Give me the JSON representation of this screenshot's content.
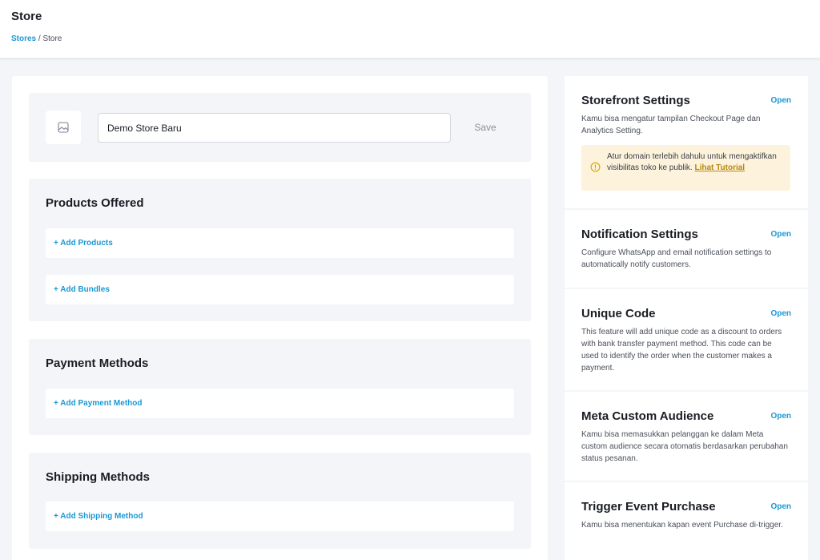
{
  "header": {
    "title": "Store",
    "breadcrumb": {
      "link": "Stores",
      "separator": "/",
      "current": "Store"
    }
  },
  "store": {
    "image_icon": "image-placeholder-icon",
    "name_value": "Demo Store Baru",
    "save_label": "Save"
  },
  "products_section": {
    "title": "Products Offered",
    "add_products": "+ Add Products",
    "add_bundles": "+ Add Bundles"
  },
  "payment_section": {
    "title": "Payment Methods",
    "add_payment": "+ Add Payment Method"
  },
  "shipping_section": {
    "title": "Shipping Methods",
    "add_shipping": "+ Add Shipping Method"
  },
  "settings": [
    {
      "title": "Storefront Settings",
      "open": "Open",
      "desc": "Kamu bisa mengatur tampilan Checkout Page dan Analytics Setting.",
      "alert": {
        "icon": "warning-circle-icon",
        "text": "Atur domain terlebih dahulu untuk mengaktifkan visibilitas toko ke publik.",
        "link": "Lihat Tutorial"
      }
    },
    {
      "title": "Notification Settings",
      "open": "Open",
      "desc": "Configure WhatsApp and email notification settings to automatically notify customers."
    },
    {
      "title": "Unique Code",
      "open": "Open",
      "desc": "This feature will add unique code as a discount to orders with bank transfer payment method. This code can be used to identify the order when the customer makes a payment."
    },
    {
      "title": "Meta Custom Audience",
      "open": "Open",
      "desc": "Kamu bisa memasukkan pelanggan ke dalam Meta custom audience secara otomatis berdasarkan perubahan status pesanan."
    },
    {
      "title": "Trigger Event Purchase",
      "open": "Open",
      "desc": "Kamu bisa menentukan kapan event Purchase di-trigger."
    }
  ],
  "colors": {
    "accent": "#1a98d5",
    "background": "#f3f5f9",
    "alert_bg": "#fdf3dd",
    "alert_link": "#b8860b"
  }
}
